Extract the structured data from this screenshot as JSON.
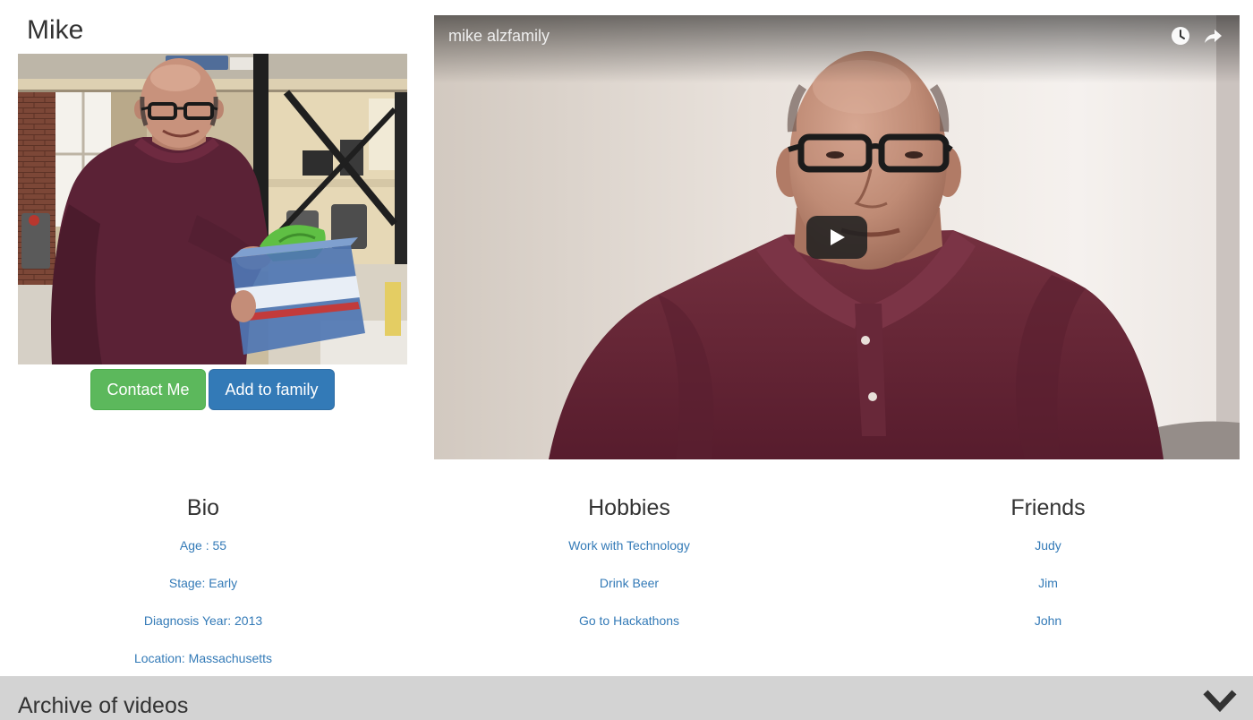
{
  "profile": {
    "name": "Mike"
  },
  "actions": {
    "contact": "Contact Me",
    "add_to_family": "Add to family"
  },
  "video": {
    "title": "mike alzfamily",
    "watch_later_icon": "clock-icon",
    "share_icon": "share-icon",
    "play_icon": "play-icon"
  },
  "bio": {
    "heading": "Bio",
    "items": [
      "Age : 55",
      "Stage: Early",
      "Diagnosis Year: 2013",
      "Location: Massachusetts"
    ]
  },
  "hobbies": {
    "heading": "Hobbies",
    "items": [
      "Work with Technology",
      "Drink Beer",
      "Go to Hackathons"
    ]
  },
  "friends": {
    "heading": "Friends",
    "items": [
      "Judy",
      "Jim",
      "John"
    ]
  },
  "archive": {
    "title": "Archive of videos",
    "toggle_icon": "chevron-down-icon"
  },
  "colors": {
    "text": "#333333",
    "link": "#337ab7",
    "contact_button": "#5cb85c",
    "family_button": "#337ab7",
    "archive_bar": "#d3d3d3"
  }
}
